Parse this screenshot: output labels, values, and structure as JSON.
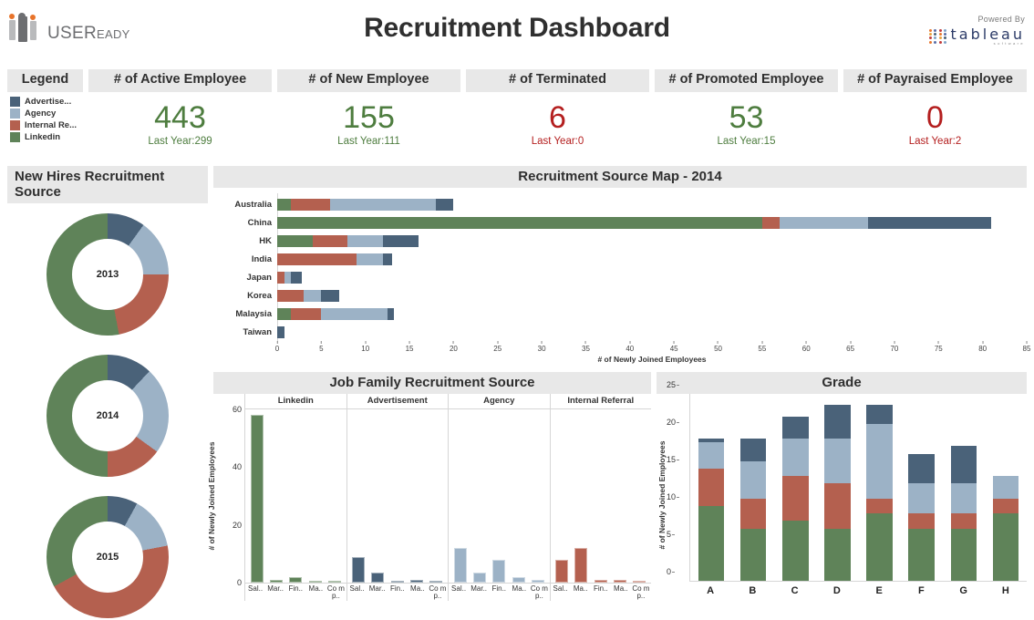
{
  "header": {
    "brand_name_main": "USER",
    "brand_name_sub": "EADY",
    "title": "Recruitment Dashboard",
    "powered_by": "Powered By",
    "tableau_word": "tableau",
    "tableau_sub": "software"
  },
  "colors": {
    "advertisement": "#4a6279",
    "agency": "#9cb2c6",
    "internal_referral": "#b4604f",
    "linkedin": "#5f8359",
    "positive": "#4e7d3f",
    "negative": "#b41f1f",
    "panel_header_bg": "#e8e8e8"
  },
  "legend": {
    "title": "Legend",
    "items": [
      {
        "label": "Advertise...",
        "color": "#4a6279"
      },
      {
        "label": "Agency",
        "color": "#9cb2c6"
      },
      {
        "label": "Internal Re...",
        "color": "#b4604f"
      },
      {
        "label": "Linkedin",
        "color": "#5f8359"
      }
    ]
  },
  "kpis": [
    {
      "title": "# of Active Employee",
      "value": "443",
      "last_year": "Last Year:299",
      "trend": "positive"
    },
    {
      "title": "# of New Employee",
      "value": "155",
      "last_year": "Last Year:111",
      "trend": "positive"
    },
    {
      "title": "# of Terminated",
      "value": "6",
      "last_year": "Last Year:0",
      "trend": "negative"
    },
    {
      "title": "# of Promoted Employee",
      "value": "53",
      "last_year": "Last Year:15",
      "trend": "positive"
    },
    {
      "title": "# of Payraised Employee",
      "value": "0",
      "last_year": "Last Year:2",
      "trend": "negative"
    }
  ],
  "sections": {
    "new_hires": "New Hires Recruitment Source",
    "source_map": "Recruitment Source Map - 2014",
    "job_family": "Job Family Recruitment Source",
    "grade": "Grade"
  },
  "chart_data": [
    {
      "type": "pie",
      "title": "New Hires Recruitment Source",
      "donuts": [
        {
          "year": "2013",
          "labels": [
            "Advertisement",
            "Agency",
            "Internal Referral",
            "Linkedin"
          ],
          "values": [
            10,
            15,
            22,
            53
          ]
        },
        {
          "year": "2014",
          "labels": [
            "Advertisement",
            "Agency",
            "Internal Referral",
            "Linkedin"
          ],
          "values": [
            12,
            23,
            15,
            50
          ]
        },
        {
          "year": "2015",
          "labels": [
            "Advertisement",
            "Agency",
            "Internal Referral",
            "Linkedin"
          ],
          "values": [
            8,
            14,
            45,
            33
          ]
        }
      ],
      "legend_position": "left"
    },
    {
      "type": "bar",
      "orientation": "horizontal",
      "stacked": true,
      "title": "Recruitment Source Map - 2014",
      "xlabel": "# of Newly Joined Employees",
      "ylabel": "",
      "xlim": [
        0,
        85
      ],
      "xticks": [
        0,
        5,
        10,
        15,
        20,
        25,
        30,
        35,
        40,
        45,
        50,
        55,
        60,
        65,
        70,
        75,
        80,
        85
      ],
      "grid": false,
      "categories": [
        "Australia",
        "China",
        "HK",
        "India",
        "Japan",
        "Korea",
        "Malaysia",
        "Taiwan"
      ],
      "series": [
        {
          "name": "Linkedin",
          "color": "#5f8359",
          "values": [
            1.5,
            55,
            4,
            0,
            0,
            0,
            1.5,
            0
          ]
        },
        {
          "name": "Internal Referral",
          "color": "#b4604f",
          "values": [
            4.5,
            2,
            4,
            9,
            0.8,
            3,
            3.5,
            0
          ]
        },
        {
          "name": "Agency",
          "color": "#9cb2c6",
          "values": [
            12,
            10,
            4,
            3,
            0.7,
            2,
            7.5,
            0
          ]
        },
        {
          "name": "Advertisement",
          "color": "#4a6279",
          "values": [
            2,
            14,
            4,
            1,
            1.3,
            2,
            0.7,
            0.8
          ]
        }
      ],
      "totals": [
        20,
        81,
        16,
        13,
        2.8,
        7,
        13.2,
        0.8
      ]
    },
    {
      "type": "bar",
      "title": "Job Family Recruitment Source",
      "ylabel": "# of Newly Joined Employees",
      "ylim": [
        0,
        60
      ],
      "yticks": [
        0,
        20,
        40,
        60
      ],
      "panels": [
        {
          "name": "Linkedin",
          "color": "#5f8359",
          "categories": [
            "Sal..",
            "Mar..",
            "Fin..",
            "Ma..",
            "Co mp.."
          ],
          "values": [
            58,
            1,
            2,
            0,
            0
          ]
        },
        {
          "name": "Advertisement",
          "color": "#4a6279",
          "categories": [
            "Sal..",
            "Mar..",
            "Fin..",
            "Ma..",
            "Co mp.."
          ],
          "values": [
            9,
            3.5,
            0,
            1,
            0
          ]
        },
        {
          "name": "Agency",
          "color": "#9cb2c6",
          "categories": [
            "Sal..",
            "Mar..",
            "Fin..",
            "Ma..",
            "Co mp.."
          ],
          "values": [
            12,
            3.5,
            8,
            2,
            0.8
          ]
        },
        {
          "name": "Internal Referral",
          "color": "#b4604f",
          "categories": [
            "Sal..",
            "Ma..",
            "Fin..",
            "Ma..",
            "Co mp.."
          ],
          "values": [
            8,
            12,
            1,
            1,
            0
          ]
        }
      ]
    },
    {
      "type": "bar",
      "stacked": true,
      "title": "Grade",
      "ylabel": "# of Newly Joined Employees",
      "ylim": [
        0,
        25
      ],
      "yticks": [
        0,
        5,
        10,
        15,
        20,
        25
      ],
      "categories": [
        "A",
        "B",
        "C",
        "D",
        "E",
        "F",
        "G",
        "H"
      ],
      "series": [
        {
          "name": "Linkedin",
          "color": "#5f8359",
          "values": [
            10,
            7,
            8,
            7,
            9,
            7,
            7,
            9
          ]
        },
        {
          "name": "Internal Referral",
          "color": "#b4604f",
          "values": [
            5,
            4,
            6,
            6,
            2,
            2,
            2,
            2
          ]
        },
        {
          "name": "Agency",
          "color": "#9cb2c6",
          "values": [
            3.5,
            5,
            5,
            6,
            10,
            4,
            4,
            3
          ]
        },
        {
          "name": "Advertisement",
          "color": "#4a6279",
          "values": [
            0.5,
            3,
            3,
            4.5,
            2.5,
            4,
            5,
            0
          ]
        }
      ],
      "totals": [
        19,
        19,
        22,
        23.5,
        23.5,
        17,
        18,
        14
      ]
    }
  ]
}
